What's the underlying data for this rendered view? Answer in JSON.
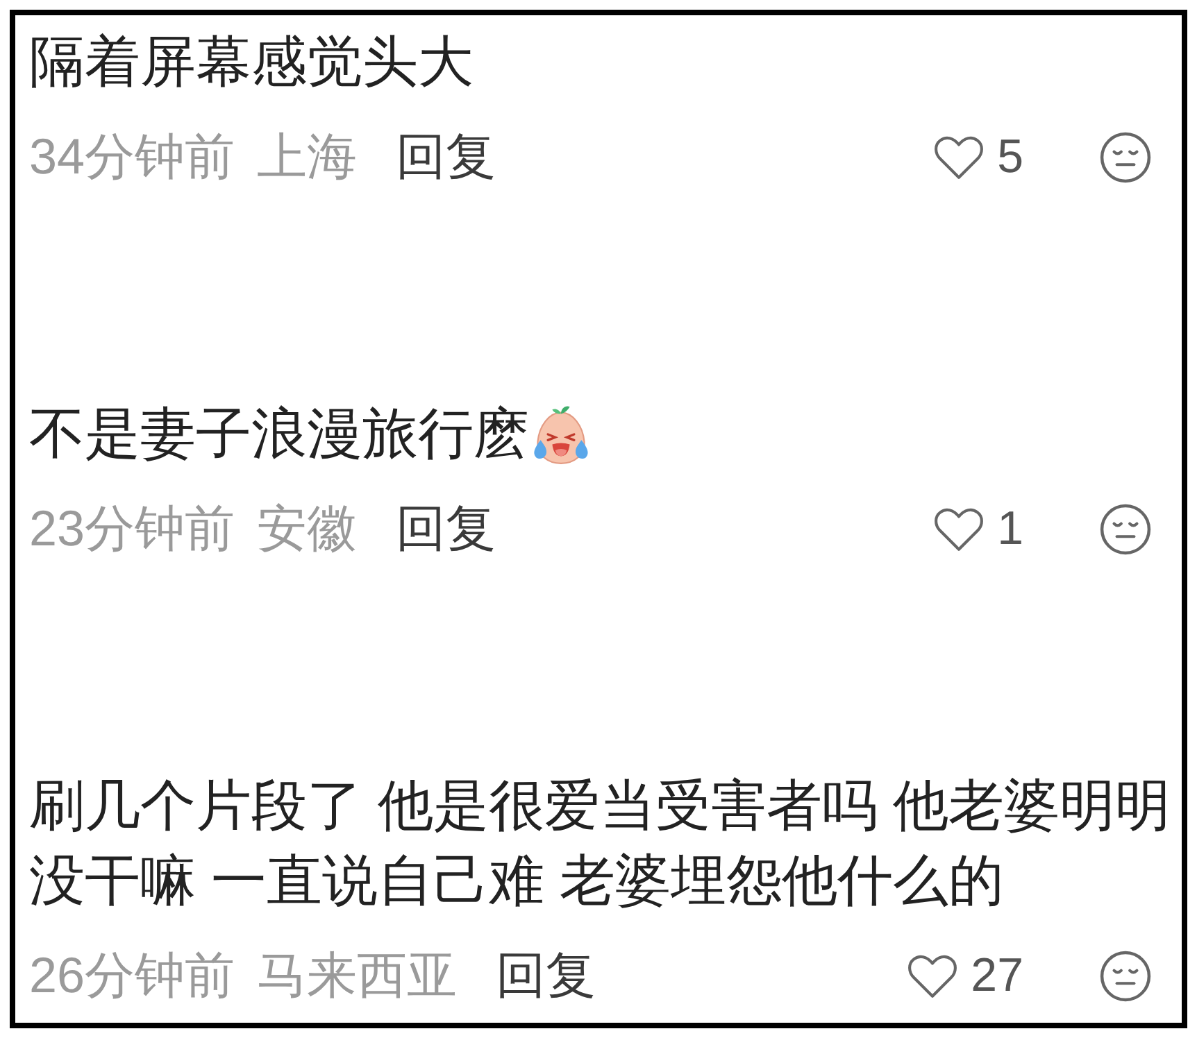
{
  "comments": [
    {
      "text": "隔着屏幕感觉头大",
      "emoji": false,
      "time": "34分钟前",
      "location": "上海",
      "reply": "回复",
      "liked": false,
      "likes": "5"
    },
    {
      "text": "不是妻子浪漫旅行麽",
      "emoji": true,
      "time": "23分钟前",
      "location": "安徽",
      "reply": "回复",
      "liked": false,
      "likes": "1"
    },
    {
      "text": "刷几个片段了 他是很爱当受害者吗 他老婆明明没干嘛 一直说自己难 老婆埋怨他什么的",
      "emoji": false,
      "time": "26分钟前",
      "location": "马来西亚",
      "reply": "回复",
      "liked": false,
      "likes": "27"
    }
  ]
}
